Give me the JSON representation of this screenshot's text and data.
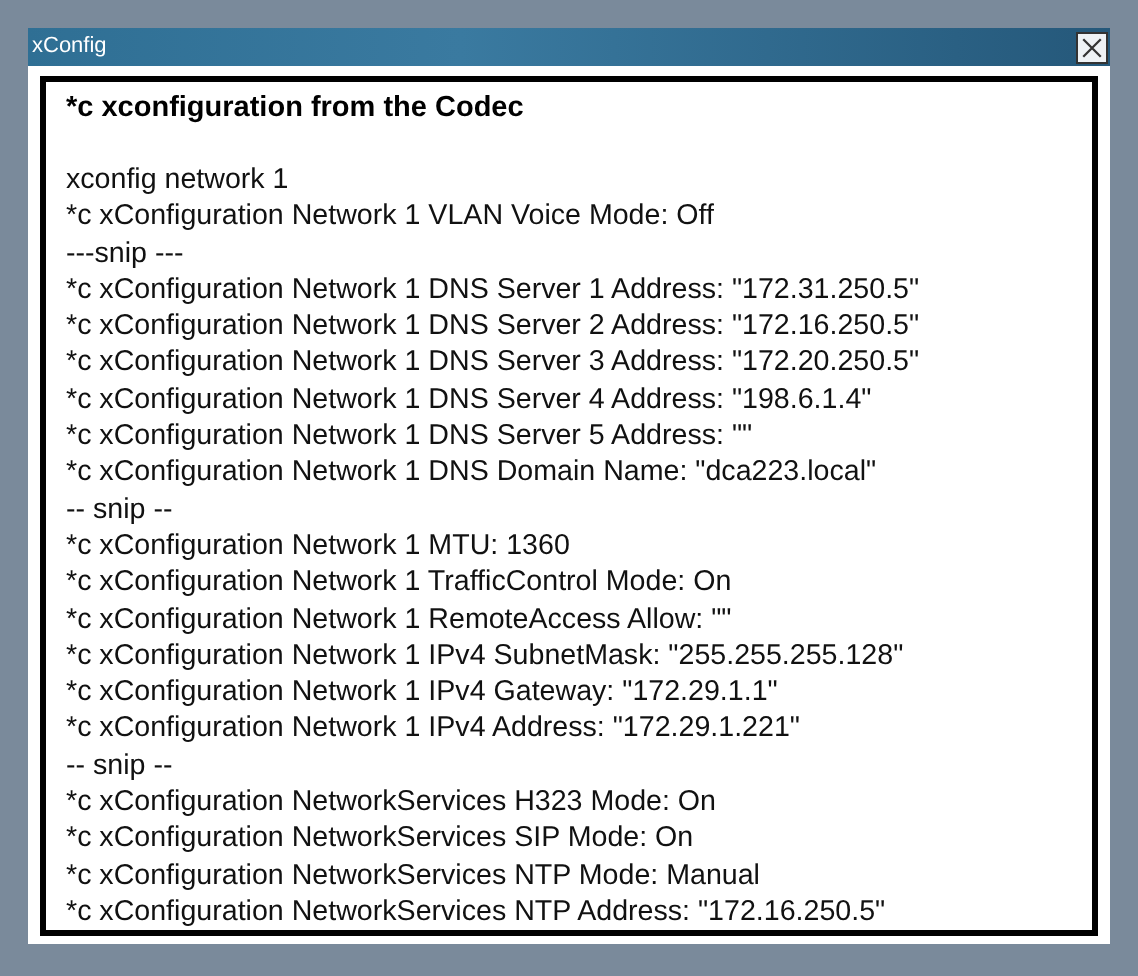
{
  "window": {
    "title": "xConfig"
  },
  "heading": "*c xconfiguration from the Codec",
  "lines": [
    "xconfig network 1",
    "*c xConfiguration Network 1 VLAN Voice Mode: Off",
    "---snip ---",
    "*c xConfiguration Network 1 DNS Server 1 Address: \"172.31.250.5\"",
    "*c xConfiguration Network 1 DNS Server 2 Address: \"172.16.250.5\"",
    "*c xConfiguration Network 1 DNS Server 3 Address: \"172.20.250.5\"",
    "*c xConfiguration Network 1 DNS Server 4 Address: \"198.6.1.4\"",
    "*c xConfiguration Network 1 DNS Server 5 Address: \"\"",
    "*c xConfiguration Network 1 DNS Domain Name: \"dca223.local\"",
    "-- snip --",
    "*c xConfiguration Network 1 MTU: 1360",
    "*c xConfiguration Network 1 TrafficControl Mode: On",
    "*c xConfiguration Network 1 RemoteAccess Allow: \"\"",
    "*c xConfiguration Network 1 IPv4 SubnetMask: \"255.255.255.128\"",
    "*c xConfiguration Network 1 IPv4 Gateway: \"172.29.1.1\"",
    "*c xConfiguration Network 1 IPv4 Address: \"172.29.1.221\"",
    "-- snip --",
    "*c xConfiguration NetworkServices H323 Mode: On",
    "*c xConfiguration NetworkServices SIP Mode: On",
    "*c xConfiguration NetworkServices NTP Mode: Manual",
    "*c xConfiguration NetworkServices NTP Address: \"172.16.250.5\""
  ]
}
